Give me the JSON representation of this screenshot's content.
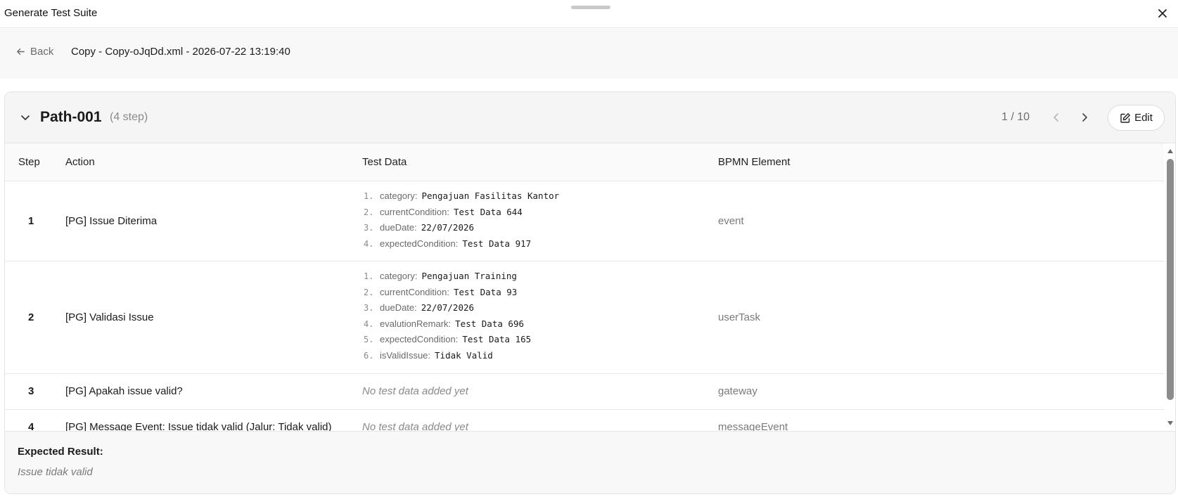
{
  "window": {
    "title": "Generate Test Suite"
  },
  "header": {
    "back_label": "Back",
    "file_title": "Copy - Copy-oJqDd.xml - 2026-07-22 13:19:40"
  },
  "path": {
    "name": "Path-001",
    "step_count": "(4 step)",
    "pager": "1 / 10",
    "edit_label": "Edit"
  },
  "table": {
    "headers": {
      "step": "Step",
      "action": "Action",
      "test_data": "Test Data",
      "element": "BPMN Element"
    },
    "no_data_text": "No test data added yet",
    "rows": [
      {
        "step": "1",
        "action": "[PG] Issue Diterima",
        "element": "event",
        "data": [
          {
            "num": "1.",
            "key": "category:",
            "value": "Pengajuan Fasilitas Kantor"
          },
          {
            "num": "2.",
            "key": "currentCondition:",
            "value": "Test Data 644"
          },
          {
            "num": "3.",
            "key": "dueDate:",
            "value": "22/07/2026"
          },
          {
            "num": "4.",
            "key": "expectedCondition:",
            "value": "Test Data 917"
          }
        ]
      },
      {
        "step": "2",
        "action": "[PG] Validasi Issue",
        "element": "userTask",
        "data": [
          {
            "num": "1.",
            "key": "category:",
            "value": "Pengajuan Training"
          },
          {
            "num": "2.",
            "key": "currentCondition:",
            "value": "Test Data 93"
          },
          {
            "num": "3.",
            "key": "dueDate:",
            "value": "22/07/2026"
          },
          {
            "num": "4.",
            "key": "evalutionRemark:",
            "value": "Test Data 696"
          },
          {
            "num": "5.",
            "key": "expectedCondition:",
            "value": "Test Data 165"
          },
          {
            "num": "6.",
            "key": "isValidIssue:",
            "value": "Tidak Valid"
          }
        ]
      },
      {
        "step": "3",
        "action": "[PG] Apakah issue valid?",
        "element": "gateway",
        "data": []
      },
      {
        "step": "4",
        "action": "[PG] Message Event: Issue tidak valid (Jalur: Tidak valid)",
        "element": "messageEvent",
        "data": []
      }
    ]
  },
  "expected": {
    "label": "Expected Result:",
    "value": "Issue tidak valid"
  },
  "icons": {
    "close": "close-icon",
    "back": "arrow-left-icon",
    "collapse": "chevron-down-icon",
    "prev": "chevron-left-icon",
    "next": "chevron-right-icon",
    "edit": "edit-icon"
  }
}
